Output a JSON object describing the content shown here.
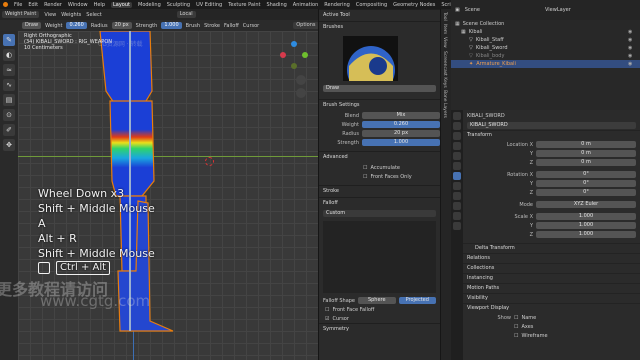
{
  "menubar": {
    "menus": [
      "File",
      "Edit",
      "Render",
      "Window",
      "Help"
    ],
    "workspaces": [
      "Layout",
      "Modeling",
      "Sculpting",
      "UV Editing",
      "Texture Paint",
      "Shading",
      "Animation",
      "Rendering",
      "Compositing",
      "Geometry Nodes",
      "Scripting"
    ],
    "active_workspace": "Layout",
    "scene": "Scene",
    "view_layer": "ViewLayer"
  },
  "viewport_header": {
    "mode": "Weight Paint",
    "menus": [
      "View",
      "Weights",
      "Select"
    ],
    "orientation": "Local",
    "options": "Options"
  },
  "tool_header": {
    "brush": "Draw",
    "weight_label": "Weight",
    "weight_value": "0.260",
    "radius_label": "Radius",
    "radius_value": "20 px",
    "strength_label": "Strength",
    "strength_value": "1.000",
    "menus": [
      "Brush",
      "Stroke",
      "Falloff",
      "Cursor"
    ]
  },
  "viewport_info": {
    "line1": "Right Orthographic",
    "line2": "(34) KIBALI_SWORD : RIG_WEAPON",
    "line3": "10 Centimeters"
  },
  "keys": [
    {
      "text": "Wheel Down x3"
    },
    {
      "text": "Shift + Middle Mouse"
    },
    {
      "text": "A"
    },
    {
      "text": "Alt + R"
    },
    {
      "text": "Shift + Middle Mouse"
    },
    {
      "text": "Ctrl + Alt"
    }
  ],
  "watermark": {
    "line1": "更多教程请访问",
    "line2": "www.cgtg.com",
    "small": "CG资源网 · 转载"
  },
  "sidebar": {
    "active_tool": "Active Tool",
    "brushes": "Brushes",
    "brush_name": "Draw",
    "brush_settings": "Brush Settings",
    "blend_label": "Blend",
    "blend_value": "Mix",
    "weight_label": "Weight",
    "weight_value": "0.260",
    "radius_label": "Radius",
    "radius_value": "20 px",
    "strength_label": "Strength",
    "strength_value": "1.000",
    "advanced": "Advanced",
    "accumulate": "Accumulate",
    "front_faces_only": "Front Faces Only",
    "stroke": "Stroke",
    "falloff": "Falloff",
    "curve_preset": "Custom",
    "falloff_shape_label": "Falloff Shape",
    "sphere": "Sphere",
    "projected": "Projected",
    "front_face_falloff": "Front Face Falloff",
    "cursor": "Cursor",
    "symmetry": "Symmetry"
  },
  "vtabs": [
    "Tool",
    "Item",
    "View",
    "Screencast Keys",
    "Bone Layers"
  ],
  "outliner": {
    "title": "Scene Collection",
    "items": [
      {
        "name": "Kibali",
        "selected": false
      },
      {
        "name": "Kibali_Staff",
        "selected": false
      },
      {
        "name": "Kibali_Sword",
        "selected": false
      },
      {
        "name": "Kibali_body",
        "selected": false
      },
      {
        "name": "Armature_Kibali",
        "selected": true
      }
    ]
  },
  "properties": {
    "object_name": "KIBALI_SWORD",
    "transform": "Transform",
    "location_x_label": "Location X",
    "location_x": "0 m",
    "location_y": "0 m",
    "location_z": "0 m",
    "rotation_x_label": "Rotation X",
    "rotation_x": "0°",
    "rotation_y": "0°",
    "rotation_z": "0°",
    "mode_label": "Mode",
    "mode_value": "XYZ Euler",
    "scale_x_label": "Scale X",
    "scale_x": "1.000",
    "scale_y": "1.000",
    "scale_z": "1.000",
    "y_label": "Y",
    "z_label": "Z",
    "delta_transform": "Delta Transform",
    "relations": "Relations",
    "collections": "Collections",
    "instancing": "Instancing",
    "motion_paths": "Motion Paths",
    "visibility": "Visibility",
    "viewport_display": "Viewport Display",
    "show_label": "Show",
    "name_opt": "Name",
    "axes_opt": "Axes",
    "wireframe_opt": "Wireframe"
  },
  "colors": {
    "accent": "#4772b3",
    "orange": "#e87d0d"
  }
}
